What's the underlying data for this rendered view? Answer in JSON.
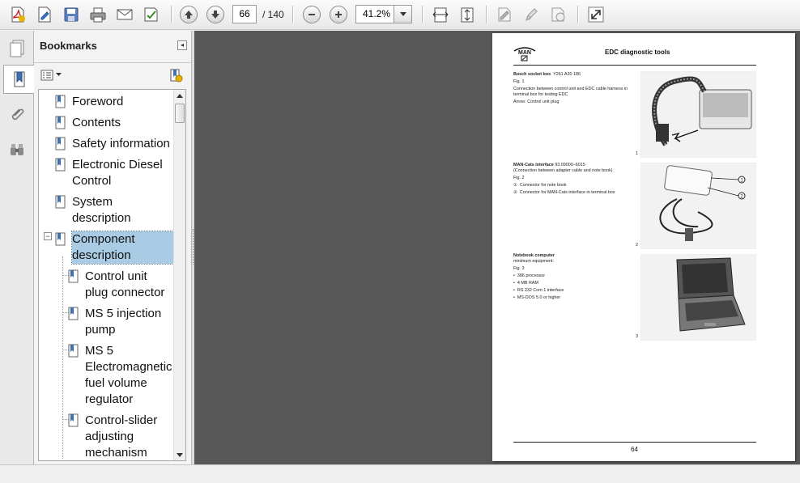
{
  "toolbar": {
    "page_current": "66",
    "page_total": "/ 140",
    "zoom": "41.2%",
    "icons": [
      "create-pdf-icon",
      "edit-icon",
      "save-icon",
      "print-icon",
      "email-icon",
      "review-icon",
      "previous-page-icon",
      "next-page-icon",
      "zoom-out-icon",
      "zoom-in-icon",
      "fit-width-icon",
      "fit-page-icon",
      "sign-icon",
      "pen-icon",
      "stamp-icon",
      "expand-icon"
    ]
  },
  "sidebar": {
    "title": "Bookmarks",
    "items": [
      {
        "label": "Foreword",
        "level": 0
      },
      {
        "label": "Contents",
        "level": 0
      },
      {
        "label": "Safety information",
        "level": 0
      },
      {
        "label": "Electronic Diesel Control",
        "level": 0
      },
      {
        "label": "System description",
        "level": 0
      },
      {
        "label": "Component description",
        "level": 0,
        "selected": true,
        "expanded": true
      },
      {
        "label": "Control unit plug connector",
        "level": 1
      },
      {
        "label": "MS 5 injection pump",
        "level": 1
      },
      {
        "label": "MS 5 Electromagnetic fuel volume regulator",
        "level": 1
      },
      {
        "label": "Control-slider adjusting mechanism",
        "level": 1
      }
    ]
  },
  "page": {
    "header_title": "EDC diagnostic tools",
    "logo_text": "MAN",
    "page_number": "64",
    "sections": [
      {
        "heading": "Bosch socket box",
        "code": "Y261 A30 186",
        "fig": "Fig. 1",
        "lines": [
          "Connection between control unit and EDC cable harness in terminal box for testing EDC",
          "Arrow: Control unit plug"
        ],
        "fig_number": "1"
      },
      {
        "heading": "MAN-Cats interface",
        "code": "93.09000–6015",
        "sub": "(Connection between adapter cable and note book)",
        "fig": "Fig. 2",
        "lines": [
          "Connector for note book",
          "Connector for MAN-Cats interface in terminal box"
        ],
        "markers": [
          "①",
          "②"
        ],
        "fig_number": "2"
      },
      {
        "heading": "Notebook computer",
        "sub": "minimum equipment:",
        "fig": "Fig. 3",
        "lines": [
          "386 processor",
          "4 MB RAM",
          "RS 232 Com 1 interface",
          "MS-DOS 5.0 or higher"
        ],
        "fig_number": "3"
      }
    ]
  }
}
